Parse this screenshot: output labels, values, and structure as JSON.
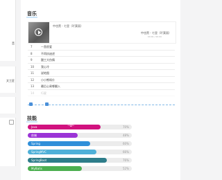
{
  "left_cards": {
    "card1_fragment": "音",
    "card2_fragment": "文工匠"
  },
  "music": {
    "title": "音乐",
    "now_playing": "中也黑 - 七里（吖莫丽）",
    "now_playing_right": "中也黑 - 七里（吖莫丽）",
    "time": "00:00 / 00:00",
    "songs": [
      {
        "num": "7",
        "name": "一直很爱"
      },
      {
        "num": "8",
        "name": "不再执迷述"
      },
      {
        "num": "9",
        "name": "酸工大伤情"
      },
      {
        "num": "10",
        "name": "我心冷"
      },
      {
        "num": "11",
        "name": "说地图"
      },
      {
        "num": "12",
        "name": "小小熊呀什"
      },
      {
        "num": "13",
        "name": "最后心易哪翻入"
      },
      {
        "num": "14",
        "name": "行星"
      }
    ]
  },
  "skills": {
    "title": "技能",
    "items": [
      {
        "name": "Java",
        "percent": 70,
        "pct_label": "70%",
        "color": "#d1127f",
        "decoration": "~✿~"
      },
      {
        "name": "前端",
        "percent": 48,
        "pct_label": "48%",
        "color": "#9b34d6"
      },
      {
        "name": "Spring",
        "percent": 60,
        "pct_label": "60%",
        "color": "#2f8fd9"
      },
      {
        "name": "SpringMVC",
        "percent": 66,
        "pct_label": "66%",
        "color": "#4fb0d8"
      },
      {
        "name": "SpringBoot",
        "percent": 76,
        "pct_label": "76%",
        "color": "#2e7d8a"
      },
      {
        "name": "MyBatis",
        "percent": 52,
        "pct_label": "52%",
        "color": "#4caf50"
      }
    ]
  }
}
